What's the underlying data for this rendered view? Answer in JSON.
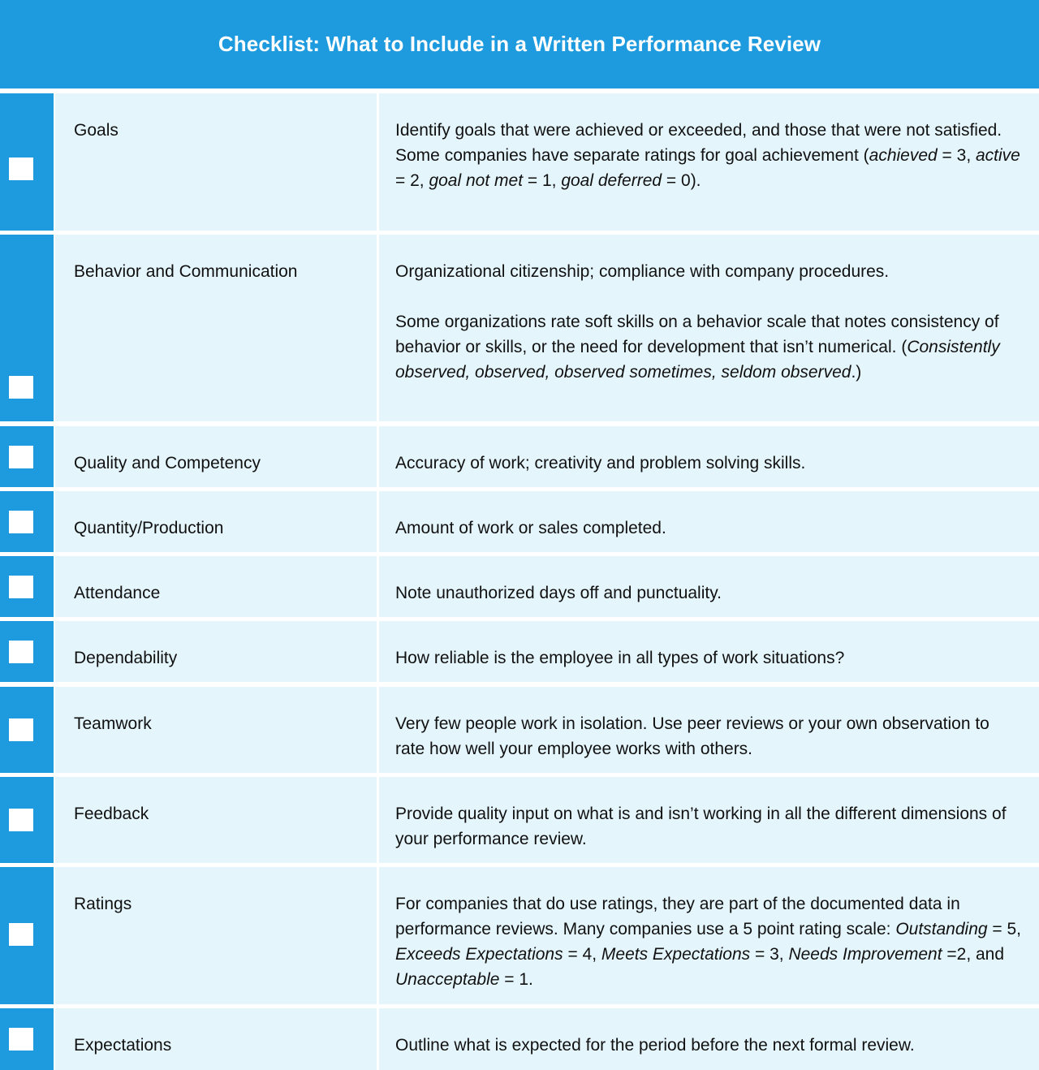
{
  "header": {
    "title": "Checklist: What to Include in a Written Performance Review"
  },
  "colors": {
    "accent": "#1e9ade",
    "row_background": "#e4f5fc",
    "text": "#111111"
  },
  "items": [
    {
      "label": "Goals",
      "checked": false,
      "paragraphs": [
        [
          {
            "t": "Identify goals that were achieved or exceeded, and those that were not satisfied."
          }
        ],
        [
          {
            "t": "Some companies have separate ratings for goal achievement ("
          },
          {
            "t": "achieved",
            "i": true
          },
          {
            "t": " = 3, "
          },
          {
            "t": "active",
            "i": true
          },
          {
            "t": " = 2, "
          },
          {
            "t": "goal not met",
            "i": true
          },
          {
            "t": " = 1, "
          },
          {
            "t": "goal deferred",
            "i": true
          },
          {
            "t": " = 0)."
          }
        ]
      ]
    },
    {
      "label": "Behavior and Communication",
      "checked": false,
      "paragraphs": [
        [
          {
            "t": "Organizational citizenship; compliance with company procedures."
          }
        ],
        [
          {
            "t": "Some organizations rate soft skills on a behavior scale that notes consistency of behavior or skills, or the need for development that isn’t numerical. ("
          },
          {
            "t": "Consistently observed, observed, observed sometimes, seldom observed",
            "i": true
          },
          {
            "t": ".)"
          }
        ]
      ],
      "paragraph_gap": true
    },
    {
      "label": "Quality and Competency",
      "checked": false,
      "paragraphs": [
        [
          {
            "t": "Accuracy of work; creativity and problem solving skills."
          }
        ]
      ]
    },
    {
      "label": "Quantity/Production",
      "checked": false,
      "paragraphs": [
        [
          {
            "t": "Amount of work or sales completed."
          }
        ]
      ]
    },
    {
      "label": "Attendance",
      "checked": false,
      "paragraphs": [
        [
          {
            "t": "Note unauthorized days off and punctuality."
          }
        ]
      ]
    },
    {
      "label": "Dependability",
      "checked": false,
      "paragraphs": [
        [
          {
            "t": "How reliable is the employee in all types of work situations?"
          }
        ]
      ]
    },
    {
      "label": "Teamwork",
      "checked": false,
      "paragraphs": [
        [
          {
            "t": "Very few people work in isolation. Use peer reviews or your own observation to rate how well your employee works with others."
          }
        ]
      ]
    },
    {
      "label": "Feedback",
      "checked": false,
      "paragraphs": [
        [
          {
            "t": "Provide quality input on what is and isn’t working in all the different dimensions of your performance review."
          }
        ]
      ]
    },
    {
      "label": "Ratings",
      "checked": false,
      "paragraphs": [
        [
          {
            "t": "For companies that do use ratings, they are part of the documented data in performance reviews. Many companies use a 5 point rating scale: "
          },
          {
            "t": "Outstanding",
            "i": true
          },
          {
            "t": " = 5, "
          },
          {
            "t": "Exceeds Expectations",
            "i": true
          },
          {
            "t": " = 4,  "
          },
          {
            "t": "Meets Expectations",
            "i": true
          },
          {
            "t": " = 3, "
          },
          {
            "t": "Needs Improvement",
            "i": true
          },
          {
            "t": " =2, and "
          },
          {
            "t": "Unacceptable",
            "i": true
          },
          {
            "t": " = 1."
          }
        ]
      ]
    },
    {
      "label": "Expectations",
      "checked": false,
      "paragraphs": [
        [
          {
            "t": "Outline what is expected for the period before the next formal review."
          }
        ]
      ]
    }
  ]
}
